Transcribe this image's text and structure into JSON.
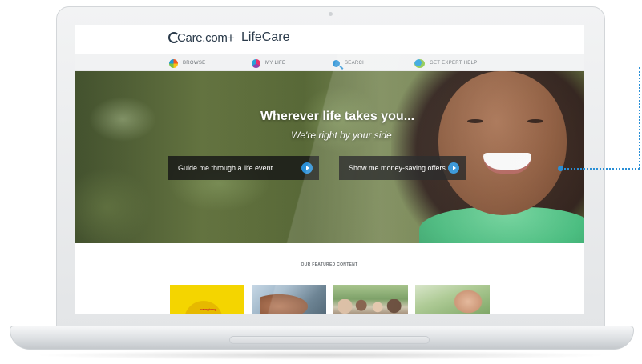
{
  "brand": {
    "care_logo": "Care.com",
    "care_logo_mark": "®",
    "plus": "+",
    "lifecare_logo": "LifeCare"
  },
  "nav": {
    "items": [
      {
        "label": "BROWSE",
        "icon": "compass-icon"
      },
      {
        "label": "MY LIFE",
        "icon": "petals-icon"
      },
      {
        "label": "SEARCH",
        "icon": "search-icon"
      },
      {
        "label": "GET EXPERT HELP",
        "icon": "chat-bubbles-icon"
      }
    ]
  },
  "hero": {
    "title": "Wherever life takes you...",
    "subtitle": "We're right by your side",
    "buttons": [
      {
        "label": "Guide me through a life event",
        "icon": "play-arrow-icon"
      },
      {
        "label": "Show me money-saving offers",
        "icon": "play-arrow-icon"
      }
    ]
  },
  "featured": {
    "heading": "OUR FEATURED CONTENT",
    "thumbnails": [
      {
        "caption": "caregiving"
      },
      {
        "caption": ""
      },
      {
        "caption": ""
      },
      {
        "caption": ""
      }
    ]
  },
  "colors": {
    "accent_blue": "#2a8fd6",
    "button_bg": "#161616",
    "nav_bg": "#f1f2f3",
    "text_dark": "#2a3a4a"
  }
}
